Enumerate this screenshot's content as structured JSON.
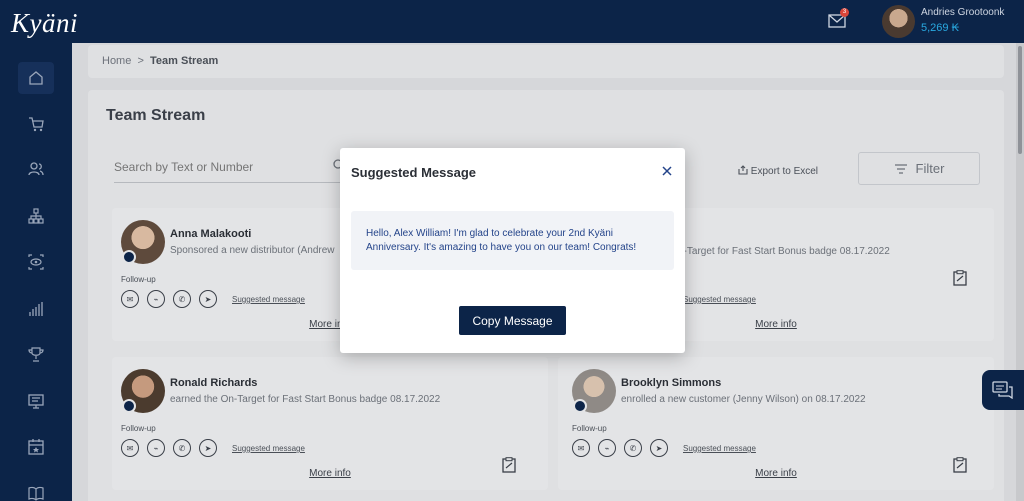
{
  "header": {
    "logo": "Kyäni",
    "mail_badge": "3",
    "user_name": "Andries Grootoonk",
    "user_points": "5,269 ₭"
  },
  "sidebar": {
    "icons": [
      "home-icon",
      "cart-icon",
      "people-icon",
      "network-icon",
      "eye-icon",
      "chart-icon",
      "trophy-icon",
      "monitor-icon",
      "calendar-icon",
      "book-icon"
    ]
  },
  "breadcrumb": {
    "home": "Home",
    "separator": ">",
    "current": "Team Stream"
  },
  "page": {
    "title": "Team Stream",
    "search_placeholder": "Search by Text or Number",
    "export_label": "Export to Excel",
    "filter_label": "Filter"
  },
  "cards": [
    {
      "name": "Anna Malakooti",
      "activity": "Sponsored a new distributor (Andrew",
      "followup": "Follow-up",
      "suggested": "Suggested message",
      "more": "More info"
    },
    {
      "name": "",
      "activity": "n-Target for Fast Start Bonus badge 08.17.2022",
      "followup": "",
      "suggested": "Suggested message",
      "more": "More info"
    },
    {
      "name": "Ronald Richards",
      "activity": "earned the On-Target for Fast Start Bonus badge 08.17.2022",
      "followup": "Follow-up",
      "suggested": "Suggested message",
      "more": "More info"
    },
    {
      "name": "Brooklyn Simmons",
      "activity": "enrolled a new customer (Jenny Wilson) on 08.17.2022",
      "followup": "Follow-up",
      "suggested": "Suggested message",
      "more": "More info"
    }
  ],
  "modal": {
    "title": "Suggested Message",
    "message": "Hello, Alex William! I'm glad to celebrate your 2nd Kyäni Anniversary. It's amazing to have you on our team! Congrats!",
    "copy_label": "Copy Message"
  },
  "colors": {
    "navy": "#0c2448",
    "accent_blue": "#29a9e0",
    "message_text": "#24448a"
  }
}
